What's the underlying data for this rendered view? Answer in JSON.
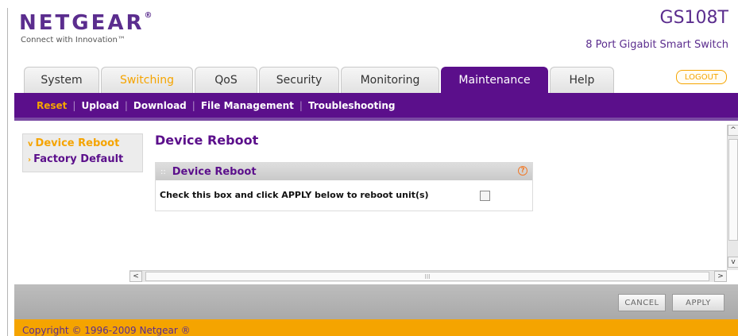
{
  "brand": {
    "logo_text": "NETGEAR",
    "logo_mark": "®",
    "tagline": "Connect with Innovation™",
    "model": "GS108T",
    "model_description": "8 Port Gigabit Smart Switch"
  },
  "tabs": [
    {
      "label": "System"
    },
    {
      "label": "Switching"
    },
    {
      "label": "QoS"
    },
    {
      "label": "Security"
    },
    {
      "label": "Monitoring"
    },
    {
      "label": "Maintenance"
    },
    {
      "label": "Help"
    }
  ],
  "logout_label": "LOGOUT",
  "subnav": [
    {
      "label": "Reset"
    },
    {
      "label": "Upload"
    },
    {
      "label": "Download"
    },
    {
      "label": "File Management"
    },
    {
      "label": "Troubleshooting"
    }
  ],
  "sidenav": {
    "items": [
      {
        "label": "Device Reboot",
        "marker": "v"
      },
      {
        "label": "Factory Default",
        "marker": "›"
      }
    ]
  },
  "main": {
    "title": "Device Reboot",
    "panel": {
      "title": "Device Reboot",
      "help_glyph": "?",
      "row_label": "Check this box and click APPLY below to reboot unit(s)",
      "checked": false
    }
  },
  "scroll": {
    "up": "^",
    "down": "v",
    "left": "<",
    "right": ">",
    "grip": "III"
  },
  "actions": {
    "cancel_label": "CANCEL",
    "apply_label": "APPLY"
  },
  "footer": {
    "copyright": "Copyright © 1996-2009 Netgear ®"
  },
  "colors": {
    "brand_purple": "#5b0f8b",
    "accent_orange": "#f5a400"
  }
}
